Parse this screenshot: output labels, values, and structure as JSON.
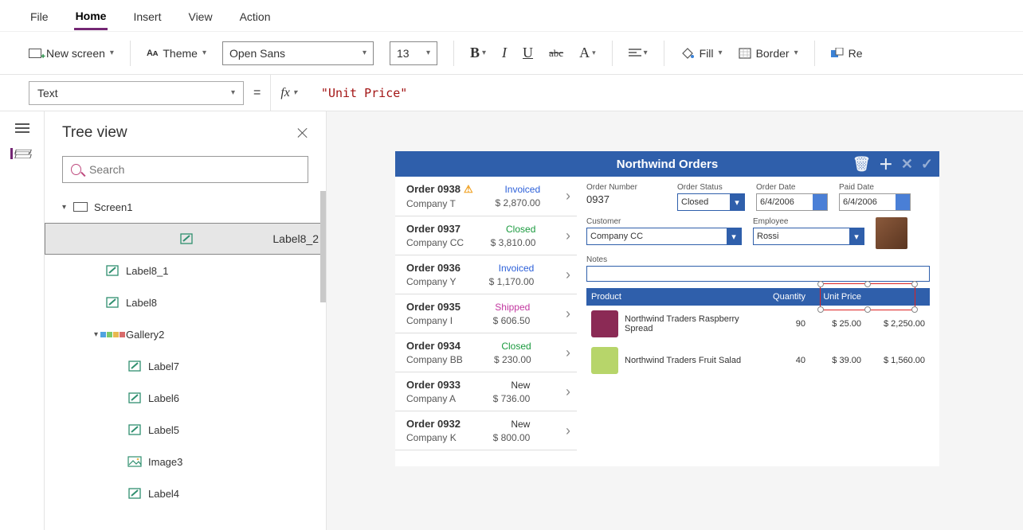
{
  "menu": {
    "items": [
      "File",
      "Home",
      "Insert",
      "View",
      "Action"
    ],
    "active": "Home"
  },
  "ribbon": {
    "new_screen": "New screen",
    "theme": "Theme",
    "font": "Open Sans",
    "size": "13",
    "fill": "Fill",
    "border": "Border",
    "reorder": "Re"
  },
  "formula_bar": {
    "property": "Text",
    "fx_label": "fx",
    "formula": "\"Unit Price\""
  },
  "tree": {
    "title": "Tree view",
    "search_placeholder": "Search",
    "items": [
      {
        "level": 1,
        "expander": "▾",
        "icon": "screen",
        "label": "Screen1"
      },
      {
        "level": 2,
        "icon": "label",
        "label": "Label8_2",
        "selected": true
      },
      {
        "level": 2,
        "icon": "label",
        "label": "Label8_1"
      },
      {
        "level": 2,
        "icon": "label",
        "label": "Label8"
      },
      {
        "level": 2,
        "expander": "▾",
        "icon": "gallery",
        "label": "Gallery2"
      },
      {
        "level": 3,
        "icon": "label",
        "label": "Label7"
      },
      {
        "level": 3,
        "icon": "label",
        "label": "Label6"
      },
      {
        "level": 3,
        "icon": "label",
        "label": "Label5"
      },
      {
        "level": 3,
        "icon": "image",
        "label": "Image3"
      },
      {
        "level": 3,
        "icon": "label",
        "label": "Label4"
      }
    ]
  },
  "app": {
    "title": "Northwind Orders",
    "orders": [
      {
        "title": "Order 0938",
        "warn": true,
        "company": "Company T",
        "status": "Invoiced",
        "amount": "$ 2,870.00"
      },
      {
        "title": "Order 0937",
        "company": "Company CC",
        "status": "Closed",
        "amount": "$ 3,810.00"
      },
      {
        "title": "Order 0936",
        "company": "Company Y",
        "status": "Invoiced",
        "amount": "$ 1,170.00"
      },
      {
        "title": "Order 0935",
        "company": "Company I",
        "status": "Shipped",
        "amount": "$ 606.50"
      },
      {
        "title": "Order 0934",
        "company": "Company BB",
        "status": "Closed",
        "amount": "$ 230.00"
      },
      {
        "title": "Order 0933",
        "company": "Company A",
        "status": "New",
        "amount": "$ 736.00"
      },
      {
        "title": "Order 0932",
        "company": "Company K",
        "status": "New",
        "amount": "$ 800.00"
      }
    ],
    "detail": {
      "labels": {
        "order_number": "Order Number",
        "order_status": "Order Status",
        "order_date": "Order Date",
        "paid_date": "Paid Date",
        "customer": "Customer",
        "employee": "Employee",
        "notes": "Notes"
      },
      "order_number": "0937",
      "order_status": "Closed",
      "order_date": "6/4/2006",
      "paid_date": "6/4/2006",
      "customer": "Company CC",
      "employee": "Rossi",
      "grid": {
        "headers": {
          "product": "Product",
          "qty": "Quantity",
          "unit": "Unit Price",
          "ext": ""
        },
        "rows": [
          {
            "name": "Northwind Traders Raspberry Spread",
            "qty": "90",
            "unit": "$ 25.00",
            "ext": "$ 2,250.00",
            "color": "#8b2a55"
          },
          {
            "name": "Northwind Traders Fruit Salad",
            "qty": "40",
            "unit": "$ 39.00",
            "ext": "$ 1,560.00",
            "color": "#b7d56a"
          }
        ]
      }
    }
  }
}
